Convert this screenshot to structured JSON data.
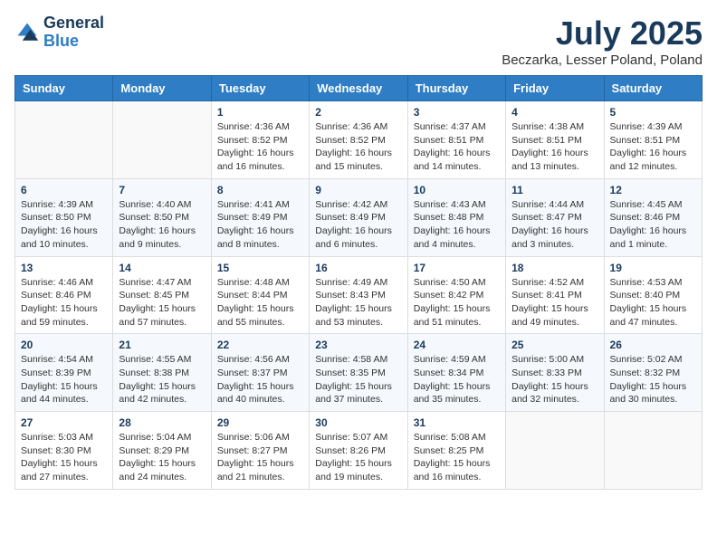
{
  "logo": {
    "line1": "General",
    "line2": "Blue"
  },
  "title": "July 2025",
  "location": "Beczarka, Lesser Poland, Poland",
  "weekdays": [
    "Sunday",
    "Monday",
    "Tuesday",
    "Wednesday",
    "Thursday",
    "Friday",
    "Saturday"
  ],
  "weeks": [
    [
      {
        "day": "",
        "info": ""
      },
      {
        "day": "",
        "info": ""
      },
      {
        "day": "1",
        "info": "Sunrise: 4:36 AM\nSunset: 8:52 PM\nDaylight: 16 hours and 16 minutes."
      },
      {
        "day": "2",
        "info": "Sunrise: 4:36 AM\nSunset: 8:52 PM\nDaylight: 16 hours and 15 minutes."
      },
      {
        "day": "3",
        "info": "Sunrise: 4:37 AM\nSunset: 8:51 PM\nDaylight: 16 hours and 14 minutes."
      },
      {
        "day": "4",
        "info": "Sunrise: 4:38 AM\nSunset: 8:51 PM\nDaylight: 16 hours and 13 minutes."
      },
      {
        "day": "5",
        "info": "Sunrise: 4:39 AM\nSunset: 8:51 PM\nDaylight: 16 hours and 12 minutes."
      }
    ],
    [
      {
        "day": "6",
        "info": "Sunrise: 4:39 AM\nSunset: 8:50 PM\nDaylight: 16 hours and 10 minutes."
      },
      {
        "day": "7",
        "info": "Sunrise: 4:40 AM\nSunset: 8:50 PM\nDaylight: 16 hours and 9 minutes."
      },
      {
        "day": "8",
        "info": "Sunrise: 4:41 AM\nSunset: 8:49 PM\nDaylight: 16 hours and 8 minutes."
      },
      {
        "day": "9",
        "info": "Sunrise: 4:42 AM\nSunset: 8:49 PM\nDaylight: 16 hours and 6 minutes."
      },
      {
        "day": "10",
        "info": "Sunrise: 4:43 AM\nSunset: 8:48 PM\nDaylight: 16 hours and 4 minutes."
      },
      {
        "day": "11",
        "info": "Sunrise: 4:44 AM\nSunset: 8:47 PM\nDaylight: 16 hours and 3 minutes."
      },
      {
        "day": "12",
        "info": "Sunrise: 4:45 AM\nSunset: 8:46 PM\nDaylight: 16 hours and 1 minute."
      }
    ],
    [
      {
        "day": "13",
        "info": "Sunrise: 4:46 AM\nSunset: 8:46 PM\nDaylight: 15 hours and 59 minutes."
      },
      {
        "day": "14",
        "info": "Sunrise: 4:47 AM\nSunset: 8:45 PM\nDaylight: 15 hours and 57 minutes."
      },
      {
        "day": "15",
        "info": "Sunrise: 4:48 AM\nSunset: 8:44 PM\nDaylight: 15 hours and 55 minutes."
      },
      {
        "day": "16",
        "info": "Sunrise: 4:49 AM\nSunset: 8:43 PM\nDaylight: 15 hours and 53 minutes."
      },
      {
        "day": "17",
        "info": "Sunrise: 4:50 AM\nSunset: 8:42 PM\nDaylight: 15 hours and 51 minutes."
      },
      {
        "day": "18",
        "info": "Sunrise: 4:52 AM\nSunset: 8:41 PM\nDaylight: 15 hours and 49 minutes."
      },
      {
        "day": "19",
        "info": "Sunrise: 4:53 AM\nSunset: 8:40 PM\nDaylight: 15 hours and 47 minutes."
      }
    ],
    [
      {
        "day": "20",
        "info": "Sunrise: 4:54 AM\nSunset: 8:39 PM\nDaylight: 15 hours and 44 minutes."
      },
      {
        "day": "21",
        "info": "Sunrise: 4:55 AM\nSunset: 8:38 PM\nDaylight: 15 hours and 42 minutes."
      },
      {
        "day": "22",
        "info": "Sunrise: 4:56 AM\nSunset: 8:37 PM\nDaylight: 15 hours and 40 minutes."
      },
      {
        "day": "23",
        "info": "Sunrise: 4:58 AM\nSunset: 8:35 PM\nDaylight: 15 hours and 37 minutes."
      },
      {
        "day": "24",
        "info": "Sunrise: 4:59 AM\nSunset: 8:34 PM\nDaylight: 15 hours and 35 minutes."
      },
      {
        "day": "25",
        "info": "Sunrise: 5:00 AM\nSunset: 8:33 PM\nDaylight: 15 hours and 32 minutes."
      },
      {
        "day": "26",
        "info": "Sunrise: 5:02 AM\nSunset: 8:32 PM\nDaylight: 15 hours and 30 minutes."
      }
    ],
    [
      {
        "day": "27",
        "info": "Sunrise: 5:03 AM\nSunset: 8:30 PM\nDaylight: 15 hours and 27 minutes."
      },
      {
        "day": "28",
        "info": "Sunrise: 5:04 AM\nSunset: 8:29 PM\nDaylight: 15 hours and 24 minutes."
      },
      {
        "day": "29",
        "info": "Sunrise: 5:06 AM\nSunset: 8:27 PM\nDaylight: 15 hours and 21 minutes."
      },
      {
        "day": "30",
        "info": "Sunrise: 5:07 AM\nSunset: 8:26 PM\nDaylight: 15 hours and 19 minutes."
      },
      {
        "day": "31",
        "info": "Sunrise: 5:08 AM\nSunset: 8:25 PM\nDaylight: 15 hours and 16 minutes."
      },
      {
        "day": "",
        "info": ""
      },
      {
        "day": "",
        "info": ""
      }
    ]
  ]
}
